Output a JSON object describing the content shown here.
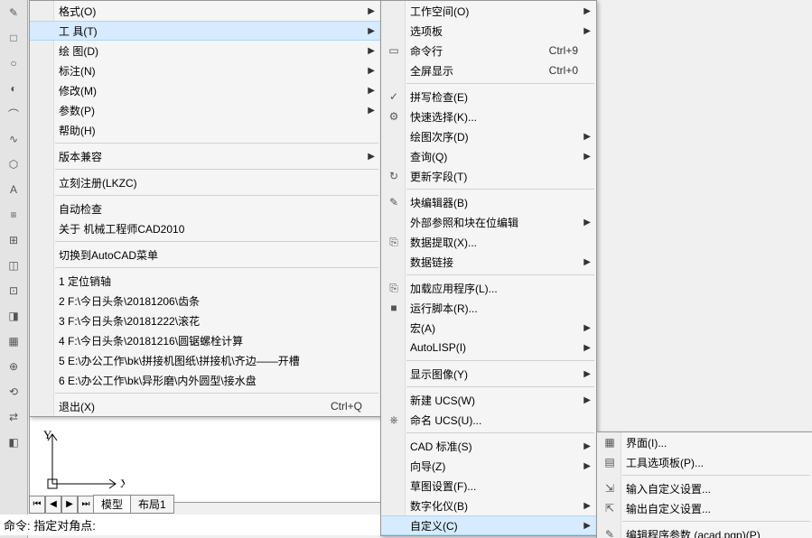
{
  "menu1": {
    "items": [
      {
        "label": "格式(O)",
        "arrow": true
      },
      {
        "label": "工 具(T)",
        "arrow": true,
        "highlight": true
      },
      {
        "label": "绘 图(D)",
        "arrow": true
      },
      {
        "label": "标注(N)",
        "arrow": true
      },
      {
        "label": "修改(M)",
        "arrow": true
      },
      {
        "label": "参数(P)",
        "arrow": true
      },
      {
        "label": "帮助(H)",
        "arrow": false
      },
      {
        "sep": true
      },
      {
        "label": "版本兼容",
        "arrow": true
      },
      {
        "sep": true
      },
      {
        "label": "立刻注册(LKZC)",
        "arrow": false
      },
      {
        "sep": true
      },
      {
        "label": "自动检查",
        "arrow": false
      },
      {
        "label": "关于 机械工程师CAD2010",
        "arrow": false
      },
      {
        "sep": true
      },
      {
        "label": "切换到AutoCAD菜单",
        "arrow": false
      },
      {
        "sep": true
      },
      {
        "label": "1 定位销轴",
        "arrow": false
      },
      {
        "label": "2 F:\\今日头条\\20181206\\齿条",
        "arrow": false
      },
      {
        "label": "3 F:\\今日头条\\20181222\\滚花",
        "arrow": false
      },
      {
        "label": "4 F:\\今日头条\\20181216\\圆锯螺栓计算",
        "arrow": false
      },
      {
        "label": "5 E:\\办公工作\\bk\\拼接机图纸\\拼接机\\齐边——开槽",
        "arrow": false
      },
      {
        "label": "6 E:\\办公工作\\bk\\异形磨\\内外圆型\\接水盘",
        "arrow": false
      },
      {
        "sep": true
      },
      {
        "label": "退出(X)",
        "shortcut": "Ctrl+Q",
        "arrow": false
      }
    ]
  },
  "menu2": {
    "items": [
      {
        "label": "工作空间(O)",
        "arrow": true
      },
      {
        "label": "选项板",
        "arrow": true
      },
      {
        "label": "命令行",
        "shortcut": "Ctrl+9",
        "icon": "▭"
      },
      {
        "label": "全屏显示",
        "shortcut": "Ctrl+0"
      },
      {
        "sep": true
      },
      {
        "label": "拼写检查(E)",
        "icon": "✓"
      },
      {
        "label": "快速选择(K)...",
        "icon": "⚙"
      },
      {
        "label": "绘图次序(D)",
        "arrow": true
      },
      {
        "label": "查询(Q)",
        "arrow": true
      },
      {
        "label": "更新字段(T)",
        "icon": "↻"
      },
      {
        "sep": true
      },
      {
        "label": "块编辑器(B)",
        "icon": "✎"
      },
      {
        "label": "外部参照和块在位编辑",
        "arrow": true
      },
      {
        "label": "数据提取(X)...",
        "icon": "⎘"
      },
      {
        "label": "数据链接",
        "arrow": true
      },
      {
        "sep": true
      },
      {
        "label": "加载应用程序(L)...",
        "icon": "⎘"
      },
      {
        "label": "运行脚本(R)...",
        "icon": "■"
      },
      {
        "label": "宏(A)",
        "arrow": true
      },
      {
        "label": "AutoLISP(I)",
        "arrow": true
      },
      {
        "sep": true
      },
      {
        "label": "显示图像(Y)",
        "arrow": true
      },
      {
        "sep": true
      },
      {
        "label": "新建 UCS(W)",
        "arrow": true
      },
      {
        "label": "命名 UCS(U)...",
        "icon": "⎈"
      },
      {
        "sep": true
      },
      {
        "label": "CAD 标准(S)",
        "arrow": true
      },
      {
        "label": "向导(Z)",
        "arrow": true
      },
      {
        "label": "草图设置(F)..."
      },
      {
        "label": "数字化仪(B)",
        "arrow": true
      },
      {
        "label": "自定义(C)",
        "arrow": true,
        "highlight": true
      }
    ]
  },
  "menu3": {
    "items": [
      {
        "label": "界面(I)...",
        "icon": "▦"
      },
      {
        "label": "工具选项板(P)...",
        "icon": "▤"
      },
      {
        "sep": true
      },
      {
        "label": "输入自定义设置...",
        "icon": "⇲"
      },
      {
        "label": "输出自定义设置...",
        "icon": "⇱"
      },
      {
        "sep": true
      },
      {
        "label": "编辑程序参数 (acad.pgp)(P)",
        "icon": "✎"
      }
    ]
  },
  "tabs": {
    "model": "模型",
    "layout1": "布局1"
  },
  "cmdline_prompt": "命令: 指定对角点:",
  "coord_y": "Y",
  "coord_x": "X",
  "toolbar_icons": [
    "✎",
    "□",
    "○",
    "◐",
    "⌒",
    "∿",
    "⬡",
    "A",
    "≡",
    "⊞",
    "◫",
    "⊡",
    "◨",
    "▦",
    "⊕",
    "⟲",
    "⇄",
    "◧"
  ]
}
